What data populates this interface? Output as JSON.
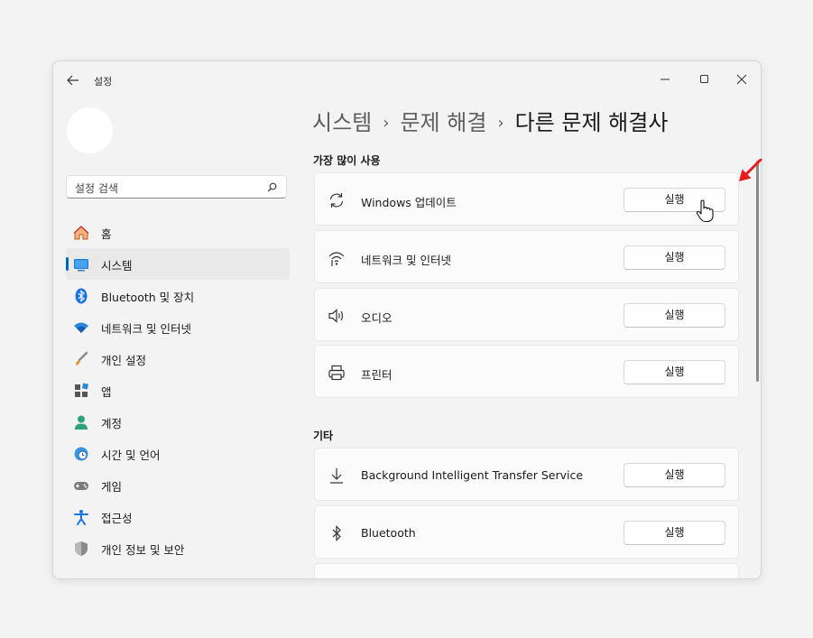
{
  "window": {
    "title": "설정"
  },
  "search": {
    "placeholder": "설정 검색"
  },
  "nav": {
    "items": [
      {
        "label": "홈",
        "icon": "home-icon"
      },
      {
        "label": "시스템",
        "icon": "system-icon",
        "active": true
      },
      {
        "label": "Bluetooth 및 장치",
        "icon": "bluetooth-icon"
      },
      {
        "label": "네트워크 및 인터넷",
        "icon": "wifi-icon"
      },
      {
        "label": "개인 설정",
        "icon": "brush-icon"
      },
      {
        "label": "앱",
        "icon": "apps-icon"
      },
      {
        "label": "계정",
        "icon": "account-icon"
      },
      {
        "label": "시간 및 언어",
        "icon": "globe-clock-icon"
      },
      {
        "label": "게임",
        "icon": "gamepad-icon"
      },
      {
        "label": "접근성",
        "icon": "accessibility-icon"
      },
      {
        "label": "개인 정보 및 보안",
        "icon": "shield-icon"
      }
    ]
  },
  "breadcrumb": {
    "part1": "시스템",
    "part2": "문제 해결",
    "current": "다른 문제 해결사",
    "separator": "›"
  },
  "sections": {
    "most_used": {
      "title": "가장 많이 사용",
      "items": [
        {
          "label": "Windows 업데이트",
          "icon": "refresh-icon",
          "button": "실행"
        },
        {
          "label": "네트워크 및 인터넷",
          "icon": "network-icon",
          "button": "실행"
        },
        {
          "label": "오디오",
          "icon": "speaker-icon",
          "button": "실행"
        },
        {
          "label": "프린터",
          "icon": "printer-icon",
          "button": "실행"
        }
      ]
    },
    "other": {
      "title": "기타",
      "items": [
        {
          "label": "Background Intelligent Transfer Service",
          "icon": "download-icon",
          "button": "실행"
        },
        {
          "label": "Bluetooth",
          "icon": "bluetooth-outline-icon",
          "button": "실행"
        }
      ]
    }
  },
  "colors": {
    "accent": "#0067c0",
    "annotation_arrow": "#e81c1c"
  }
}
